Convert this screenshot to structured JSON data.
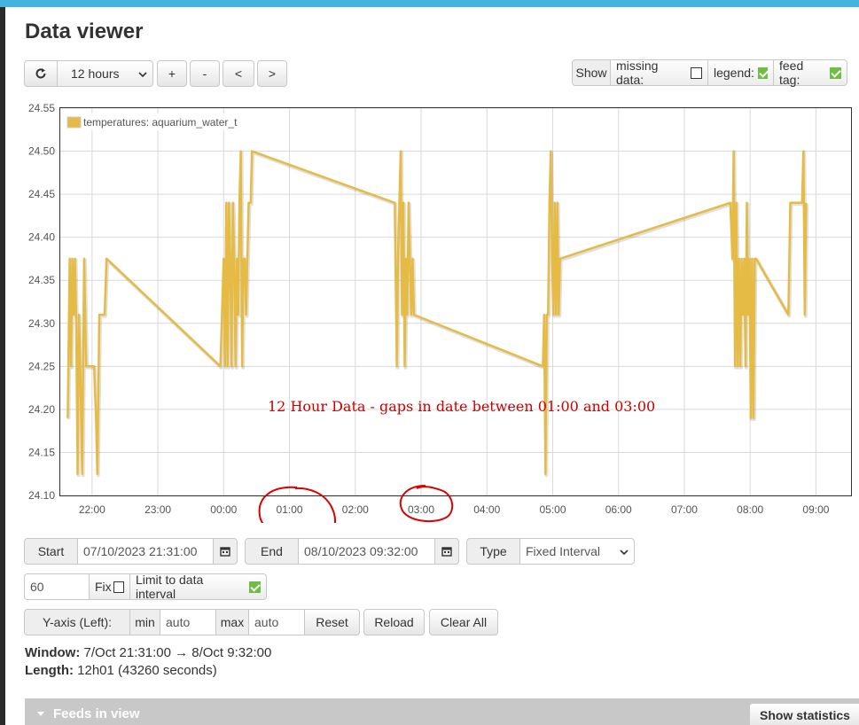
{
  "page": {
    "title": "Data viewer"
  },
  "toolbar": {
    "interval_select": "12 hours",
    "zoom_in": "+",
    "zoom_out": "-",
    "pan_left": "<",
    "pan_right": ">",
    "show_label": "Show",
    "missing_data_label": "missing data:",
    "missing_data_checked": false,
    "legend_label": "legend:",
    "legend_checked": true,
    "feed_tag_label": "feed tag:",
    "feed_tag_checked": true
  },
  "annotation": {
    "text": "12 Hour Data - gaps in date between 01:00 and 03:00",
    "color": "#cc0000"
  },
  "chart_data": {
    "type": "line",
    "legend": "temperatures: aquarium_water_t",
    "color": "#e6bb45",
    "y_ticks": [
      "24.55",
      "24.50",
      "24.45",
      "24.40",
      "24.35",
      "24.30",
      "24.25",
      "24.20",
      "24.15",
      "24.10"
    ],
    "ylim": [
      24.1,
      24.55
    ],
    "x_ticks": [
      "22:00",
      "23:00",
      "00:00",
      "01:00",
      "02:00",
      "03:00",
      "04:00",
      "05:00",
      "06:00",
      "07:00",
      "08:00",
      "09:00"
    ],
    "x_tick_hours": [
      22,
      23,
      24,
      25,
      26,
      27,
      28,
      29,
      30,
      31,
      32,
      33
    ],
    "xlim": [
      21.517,
      33.533
    ],
    "series": [
      {
        "points": [
          [
            21.63,
            24.19
          ],
          [
            21.66,
            24.375
          ],
          [
            21.68,
            24.25
          ],
          [
            21.7,
            24.375
          ],
          [
            21.72,
            24.31
          ],
          [
            21.74,
            24.375
          ],
          [
            21.76,
            24.3
          ],
          [
            21.78,
            24.125
          ],
          [
            21.8,
            24.31
          ],
          [
            21.82,
            24.25
          ],
          [
            21.85,
            24.125
          ],
          [
            21.88,
            24.375
          ],
          [
            21.91,
            24.25
          ],
          [
            21.94,
            24.25
          ],
          [
            21.97,
            24.25
          ],
          [
            22.0,
            24.25
          ],
          [
            22.03,
            24.25
          ],
          [
            22.06,
            24.19
          ],
          [
            22.08,
            24.125
          ],
          [
            22.11,
            24.31
          ],
          [
            22.15,
            24.31
          ],
          [
            22.19,
            24.31
          ],
          [
            22.22,
            24.375
          ],
          [
            23.95,
            24.25
          ],
          [
            24.0,
            24.375
          ],
          [
            24.02,
            24.25
          ],
          [
            24.04,
            24.44
          ],
          [
            24.06,
            24.25
          ],
          [
            24.08,
            24.44
          ],
          [
            24.1,
            24.375
          ],
          [
            24.12,
            24.25
          ],
          [
            24.14,
            24.44
          ],
          [
            24.16,
            24.375
          ],
          [
            24.18,
            24.25
          ],
          [
            24.2,
            24.375
          ],
          [
            24.22,
            24.31
          ],
          [
            24.24,
            24.44
          ],
          [
            24.26,
            24.5
          ],
          [
            24.28,
            24.25
          ],
          [
            24.3,
            24.375
          ],
          [
            24.32,
            24.375
          ],
          [
            24.34,
            24.31
          ],
          [
            24.36,
            24.375
          ],
          [
            24.38,
            24.44
          ],
          [
            24.41,
            24.44
          ],
          [
            24.43,
            24.5
          ],
          [
            26.6,
            24.44
          ],
          [
            26.63,
            24.25
          ],
          [
            26.65,
            24.375
          ],
          [
            26.67,
            24.44
          ],
          [
            26.69,
            24.5
          ],
          [
            26.71,
            24.31
          ],
          [
            26.73,
            24.44
          ],
          [
            26.75,
            24.25
          ],
          [
            26.77,
            24.375
          ],
          [
            26.79,
            24.31
          ],
          [
            26.81,
            24.44
          ],
          [
            26.83,
            24.375
          ],
          [
            26.85,
            24.31
          ],
          [
            26.87,
            24.375
          ],
          [
            26.89,
            24.31
          ],
          [
            28.85,
            24.25
          ],
          [
            28.87,
            24.31
          ],
          [
            28.89,
            24.125
          ],
          [
            28.91,
            24.31
          ],
          [
            28.93,
            24.31
          ],
          [
            28.95,
            24.44
          ],
          [
            28.97,
            24.5
          ],
          [
            28.99,
            24.375
          ],
          [
            29.01,
            24.31
          ],
          [
            29.03,
            24.44
          ],
          [
            29.05,
            24.31
          ],
          [
            29.07,
            24.44
          ],
          [
            29.09,
            24.31
          ],
          [
            29.11,
            24.375
          ],
          [
            31.7,
            24.44
          ],
          [
            31.73,
            24.375
          ],
          [
            31.75,
            24.5
          ],
          [
            31.77,
            24.25
          ],
          [
            31.79,
            24.44
          ],
          [
            31.81,
            24.25
          ],
          [
            31.83,
            24.375
          ],
          [
            31.85,
            24.25
          ],
          [
            31.87,
            24.375
          ],
          [
            31.89,
            24.31
          ],
          [
            31.91,
            24.375
          ],
          [
            31.93,
            24.25
          ],
          [
            31.95,
            24.44
          ],
          [
            31.97,
            24.31
          ],
          [
            31.99,
            24.375
          ],
          [
            32.01,
            24.19
          ],
          [
            32.03,
            24.375
          ],
          [
            32.05,
            24.19
          ],
          [
            32.07,
            24.375
          ],
          [
            32.09,
            24.375
          ],
          [
            32.58,
            24.31
          ],
          [
            32.61,
            24.44
          ],
          [
            32.7,
            24.44
          ],
          [
            32.77,
            24.44
          ],
          [
            32.79,
            24.44
          ],
          [
            32.81,
            24.5
          ],
          [
            32.83,
            24.31
          ],
          [
            32.85,
            24.44
          ]
        ]
      }
    ]
  }
}
